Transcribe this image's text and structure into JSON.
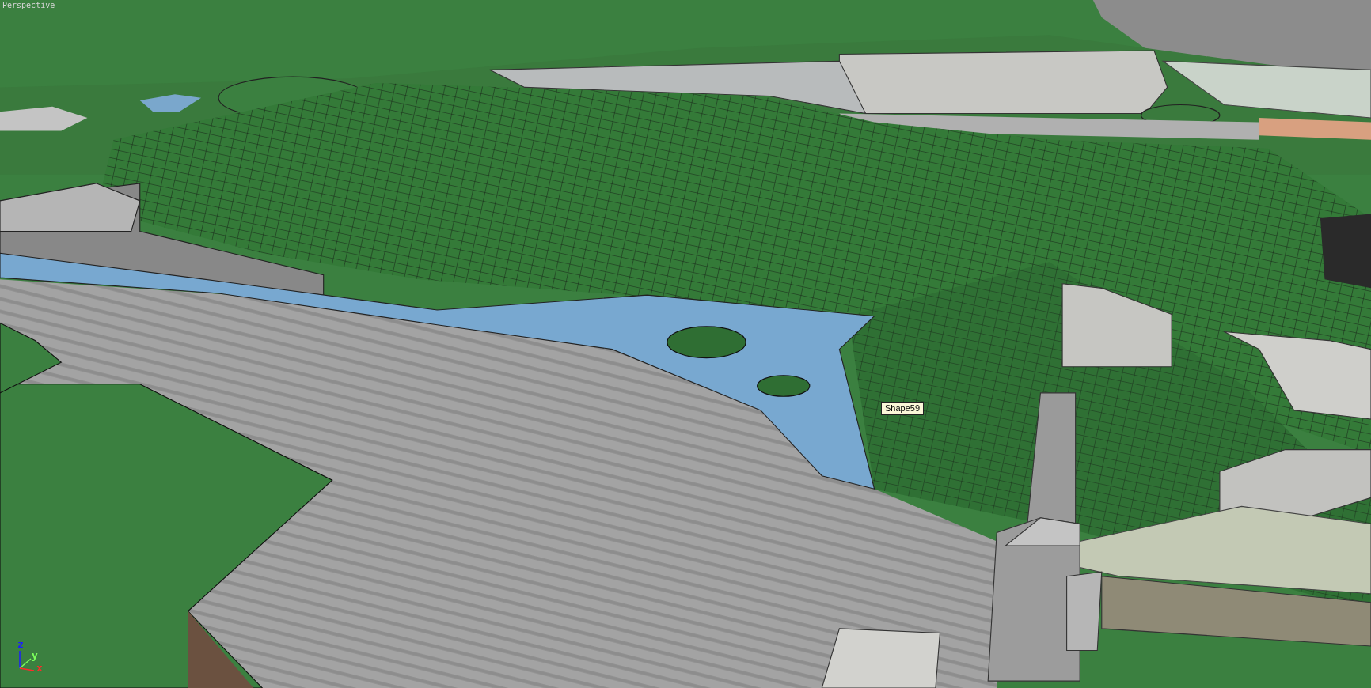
{
  "viewport": {
    "label": "Perspective"
  },
  "tooltip": {
    "text": "Shape59"
  },
  "axis_gizmo": [
    {
      "label": "z",
      "color": "#1c1cff"
    },
    {
      "label": "y",
      "color": "#7cff5c"
    },
    {
      "label": "x",
      "color": "#ff2a2a"
    }
  ]
}
